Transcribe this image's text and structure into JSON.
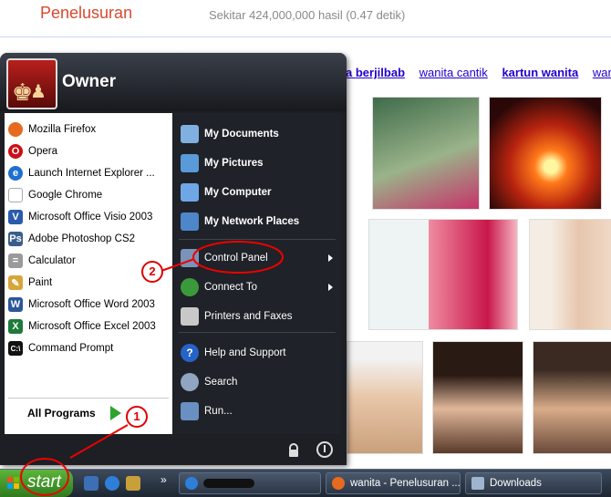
{
  "search_page": {
    "title": "Penelusuran",
    "stats": "Sekitar 424,000,000 hasil (0.47 detik)",
    "related": [
      {
        "text": "a berjilbab",
        "bold": true
      },
      {
        "text": "wanita cantik",
        "bold": false
      },
      {
        "text": "kartun wanita",
        "bold": false
      },
      {
        "text": "wanita",
        "bold": false
      }
    ]
  },
  "start_menu": {
    "user": "Owner",
    "left_items": [
      {
        "label": "Mozilla Firefox",
        "icon": "firefox-icon",
        "color": "#e66a1f"
      },
      {
        "label": "Opera",
        "icon": "opera-icon",
        "color": "#cc0f16"
      },
      {
        "label": "Launch Internet Explorer ...",
        "icon": "internet-explorer-icon",
        "color": "#1f6fd1"
      },
      {
        "label": "Google Chrome",
        "icon": "chrome-icon",
        "color": "#e6e6e6"
      },
      {
        "label": "Microsoft Office Visio 2003",
        "icon": "visio-icon",
        "color": "#2a5caa"
      },
      {
        "label": "Adobe Photoshop CS2",
        "icon": "photoshop-icon",
        "color": "#3a5e8c"
      },
      {
        "label": "Calculator",
        "icon": "calculator-icon",
        "color": "#9a9a9a"
      },
      {
        "label": "Paint",
        "icon": "paint-icon",
        "color": "#d7a63a"
      },
      {
        "label": "Microsoft Office Word 2003",
        "icon": "word-icon",
        "color": "#2b579a"
      },
      {
        "label": "Microsoft Office Excel 2003",
        "icon": "excel-icon",
        "color": "#1d7a3a"
      },
      {
        "label": "Command Prompt",
        "icon": "command-prompt-icon",
        "color": "#111111"
      }
    ],
    "all_programs": "All Programs",
    "right_items": [
      {
        "label": "My Documents",
        "icon": "documents-icon",
        "bold": true,
        "color": "#7fb0e0"
      },
      {
        "label": "My Pictures",
        "icon": "pictures-icon",
        "bold": true,
        "color": "#5a9ad8"
      },
      {
        "label": "My Computer",
        "icon": "computer-icon",
        "bold": true,
        "color": "#6fa7e6"
      },
      {
        "label": "My Network Places",
        "icon": "network-icon",
        "bold": true,
        "color": "#4d86c9"
      },
      {
        "label": "Control Panel",
        "icon": "control-panel-icon",
        "bold": false,
        "color": "#7a93b8"
      },
      {
        "label": "Connect To",
        "icon": "connect-icon",
        "bold": false,
        "color": "#3a9a3a"
      },
      {
        "label": "Printers and Faxes",
        "icon": "printer-icon",
        "bold": false,
        "color": "#c8c8c8"
      },
      {
        "label": "Help and Support",
        "icon": "help-icon",
        "bold": false,
        "color": "#2563c9"
      },
      {
        "label": "Search",
        "icon": "search-icon",
        "bold": false,
        "color": "#8fa5c0"
      },
      {
        "label": "Run...",
        "icon": "run-icon",
        "bold": false,
        "color": "#6a8fc2"
      }
    ]
  },
  "taskbar": {
    "start_label": "start",
    "tasks": [
      {
        "label": "",
        "icon": "internet-explorer-icon",
        "redacted": true
      },
      {
        "label": "wanita - Penelusuran ...",
        "icon": "firefox-icon"
      },
      {
        "label": "Downloads",
        "icon": "downloads-icon"
      }
    ],
    "more": "»"
  },
  "annotations": [
    {
      "number": "1"
    },
    {
      "number": "2"
    }
  ]
}
